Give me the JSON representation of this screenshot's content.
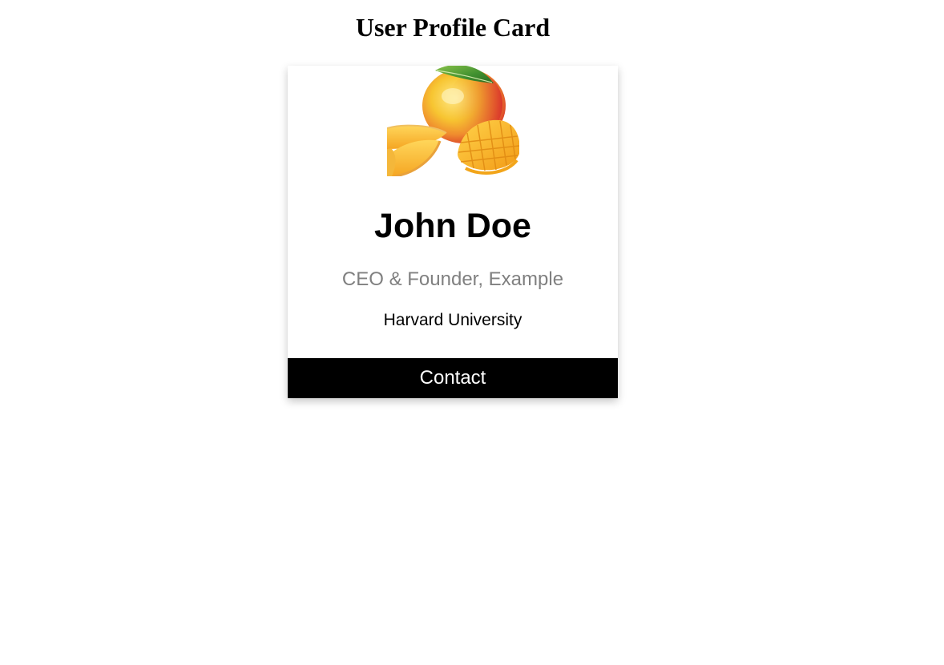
{
  "page": {
    "title": "User Profile Card"
  },
  "card": {
    "avatar_icon": "mango-image",
    "name": "John Doe",
    "title": "CEO & Founder, Example",
    "organization": "Harvard University",
    "contact_label": "Contact"
  },
  "colors": {
    "title_text": "#808080",
    "button_bg": "#000000",
    "button_text": "#ffffff"
  }
}
